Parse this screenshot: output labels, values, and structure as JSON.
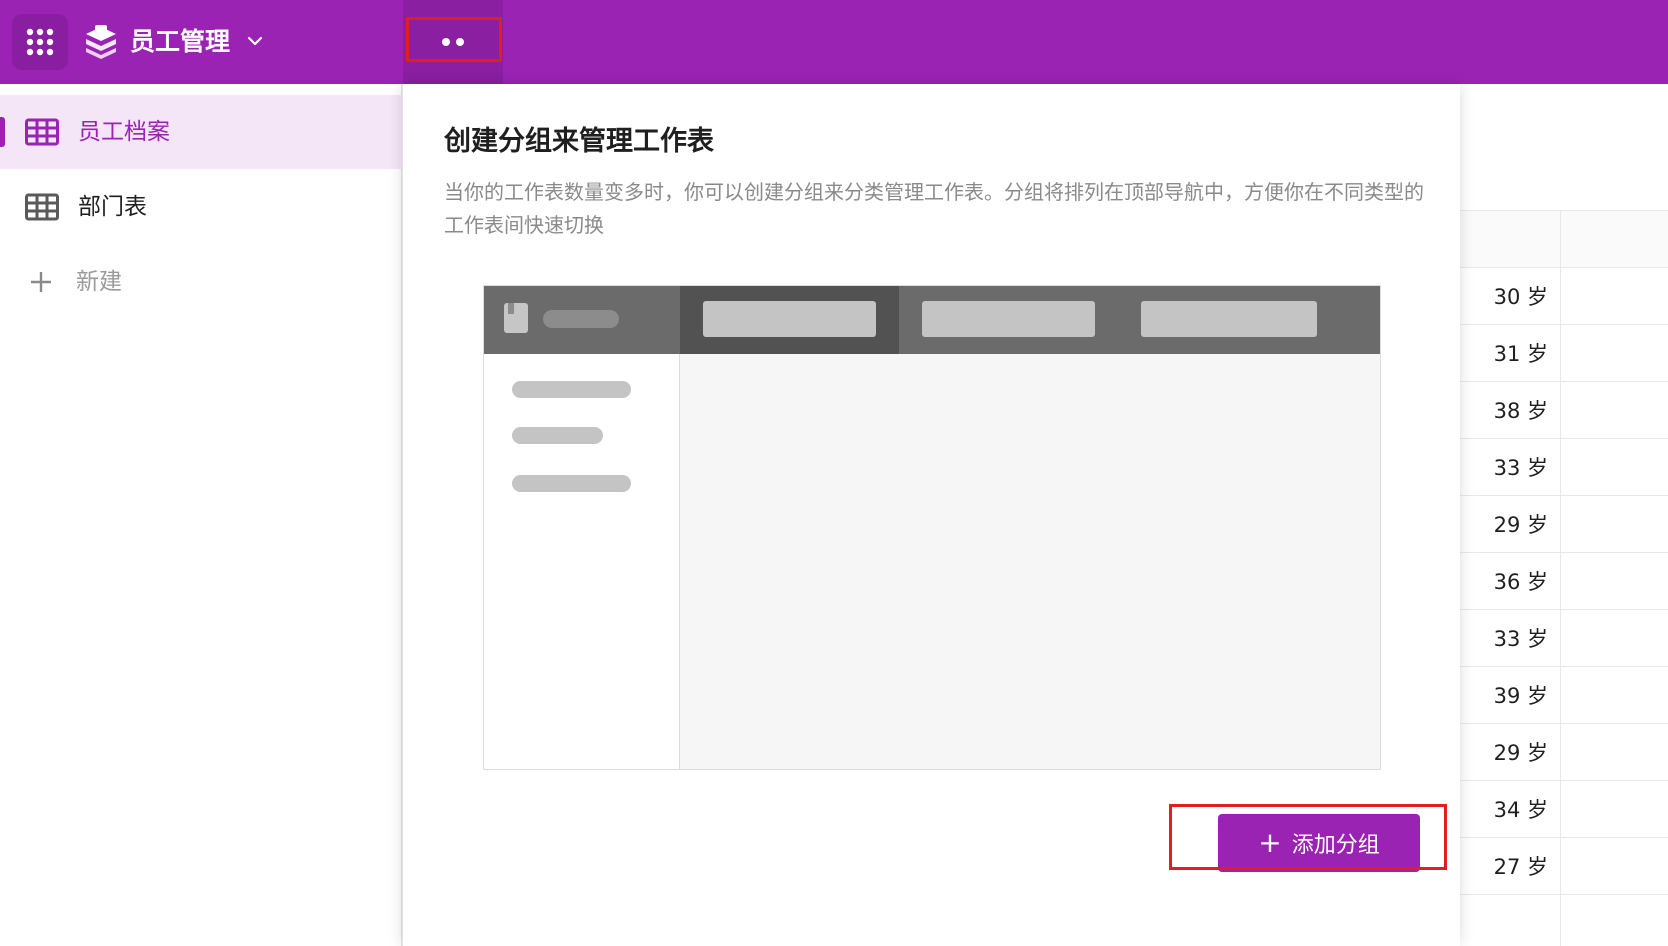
{
  "topbar": {
    "app_name": "员工管理",
    "brand_color": "#9b23b3",
    "icons": {
      "apps": "app-grid-icon",
      "logo": "layers-logo-icon",
      "dropdown": "chevron-down-icon",
      "more": "more-dots-icon"
    }
  },
  "sidebar": {
    "items": [
      {
        "label": "员工档案",
        "icon": "table-icon",
        "active": true
      },
      {
        "label": "部门表",
        "icon": "table-icon",
        "active": false
      }
    ],
    "new_label": "新建"
  },
  "panel": {
    "title": "创建分组来管理工作表",
    "description": "当你的工作表数量变多时，你可以创建分组来分类管理工作表。分组将排列在顶部导航中，方便你在不同类型的工作表间快速切换",
    "add_button_label": "添加分组"
  },
  "background_table": {
    "ages": [
      "30 岁",
      "31 岁",
      "38 岁",
      "33 岁",
      "29 岁",
      "36 岁",
      "33 岁",
      "39 岁",
      "29 岁",
      "34 岁",
      "27 岁"
    ]
  },
  "highlight_color": "#e0201f"
}
